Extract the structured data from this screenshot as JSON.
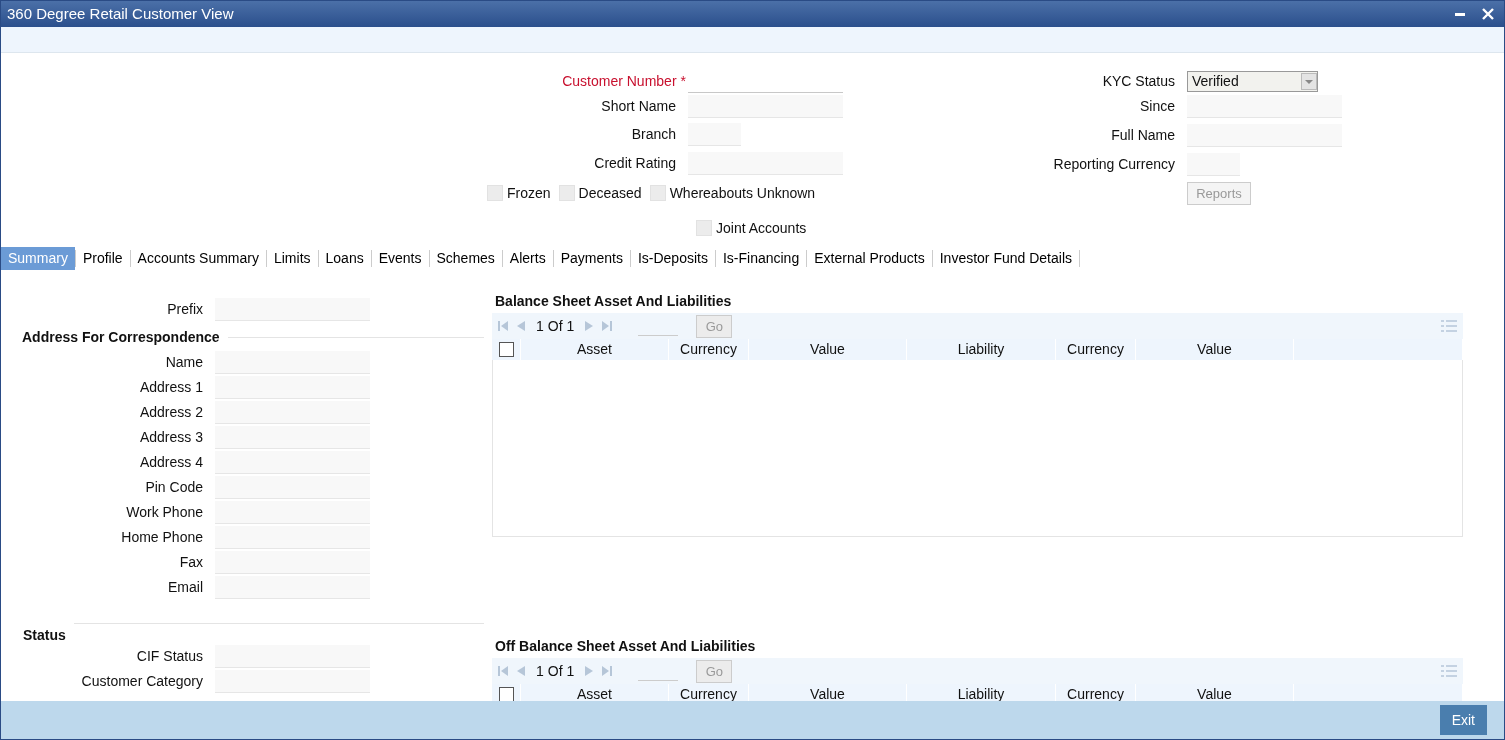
{
  "window": {
    "title": "360 Degree Retail Customer View"
  },
  "header": {
    "left_fields": [
      {
        "label": "Customer Number",
        "required": true,
        "marker": "*",
        "kind": "underline"
      },
      {
        "label": "Short Name",
        "required": false,
        "kind": "text"
      },
      {
        "label": "Branch",
        "required": false,
        "kind": "short"
      },
      {
        "label": "Credit Rating",
        "required": false,
        "kind": "text"
      }
    ],
    "flags": [
      {
        "label": "Frozen",
        "checked": false
      },
      {
        "label": "Deceased",
        "checked": false
      },
      {
        "label": "Whereabouts Unknown",
        "checked": false
      }
    ],
    "joint": {
      "label": "Joint Accounts",
      "checked": false
    },
    "right_fields": [
      {
        "label": "KYC Status",
        "kind": "select",
        "value": "Verified"
      },
      {
        "label": "Since",
        "kind": "text"
      },
      {
        "label": "Full Name",
        "kind": "text"
      },
      {
        "label": "Reporting Currency",
        "kind": "short"
      }
    ],
    "reports_button": {
      "label": "Reports",
      "disabled": true
    }
  },
  "tabs": [
    {
      "label": "Summary",
      "selected": true
    },
    {
      "label": "Profile",
      "selected": false
    },
    {
      "label": "Accounts Summary",
      "selected": false
    },
    {
      "label": "Limits",
      "selected": false
    },
    {
      "label": "Loans",
      "selected": false
    },
    {
      "label": "Events",
      "selected": false
    },
    {
      "label": "Schemes",
      "selected": false
    },
    {
      "label": "Alerts",
      "selected": false
    },
    {
      "label": "Payments",
      "selected": false
    },
    {
      "label": "Is-Deposits",
      "selected": false
    },
    {
      "label": "Is-Financing",
      "selected": false
    },
    {
      "label": "External Products",
      "selected": false
    },
    {
      "label": "Investor Fund Details",
      "selected": false
    }
  ],
  "summary": {
    "prefix": {
      "label": "Prefix"
    },
    "sections": [
      {
        "title": "Address For Correspondence",
        "fields": [
          "Name",
          "Address 1",
          "Address 2",
          "Address 3",
          "Address 4",
          "Pin Code",
          "Work Phone",
          "Home Phone",
          "Fax",
          "Email"
        ]
      },
      {
        "title": "Status",
        "fields": [
          "CIF Status",
          "Customer Category"
        ]
      }
    ],
    "grids": [
      {
        "title": "Balance Sheet Asset And Liabilities",
        "page": "1",
        "of": "Of",
        "total": "1",
        "go": {
          "label": "Go",
          "disabled": true
        },
        "select_all": false,
        "columns": [
          "Asset",
          "Currency",
          "Value",
          "Liability",
          "Currency",
          "Value"
        ]
      },
      {
        "title": "Off Balance Sheet Asset And Liabilities",
        "page": "1",
        "of": "Of",
        "total": "1",
        "go": {
          "label": "Go",
          "disabled": true
        },
        "select_all": false,
        "columns": [
          "Asset",
          "Currency",
          "Value",
          "Liability",
          "Currency",
          "Value"
        ]
      }
    ]
  },
  "footer": {
    "exit_button": "Exit"
  }
}
